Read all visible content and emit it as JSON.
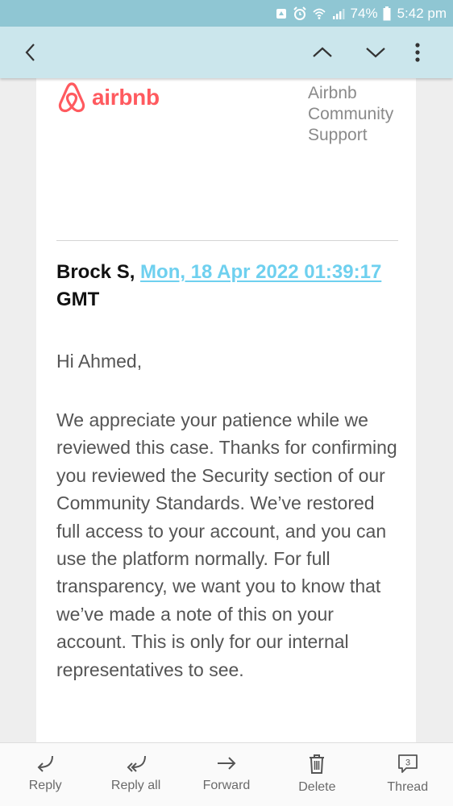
{
  "status_bar": {
    "battery_percent": "74%",
    "time": "5:42 pm",
    "icons": [
      "notification-icon",
      "alarm-icon",
      "wifi-icon",
      "signal-icon",
      "battery-icon"
    ]
  },
  "app_bar": {
    "icons": [
      "back-arrow-icon",
      "chevron-up-icon",
      "chevron-down-icon",
      "more-vert-icon"
    ]
  },
  "email": {
    "brand": "airbnb",
    "sender_name": "Airbnb Community Support",
    "author": "Brock S,",
    "date": "Mon, 18 Apr 2022 01:39:17",
    "timezone": "GMT",
    "greeting": "Hi Ahmed,",
    "body": "We appreciate your patience while we reviewed this case. Thanks for confirming you reviewed the Security section of our Community Standards. We’ve restored full access to your account, and you can use the platform normally. For full transparency, we want you to know that we’ve made a note of this on your account. This is only for our internal representatives to see."
  },
  "actions": {
    "reply": "Reply",
    "reply_all": "Reply all",
    "forward": "Forward",
    "delete": "Delete",
    "thread": "Thread",
    "thread_count": "3"
  },
  "colors": {
    "status_bar": "#8fc6d3",
    "app_bar": "#cbe6ec",
    "brand": "#ff5a5f",
    "link": "#6ed0ef"
  }
}
